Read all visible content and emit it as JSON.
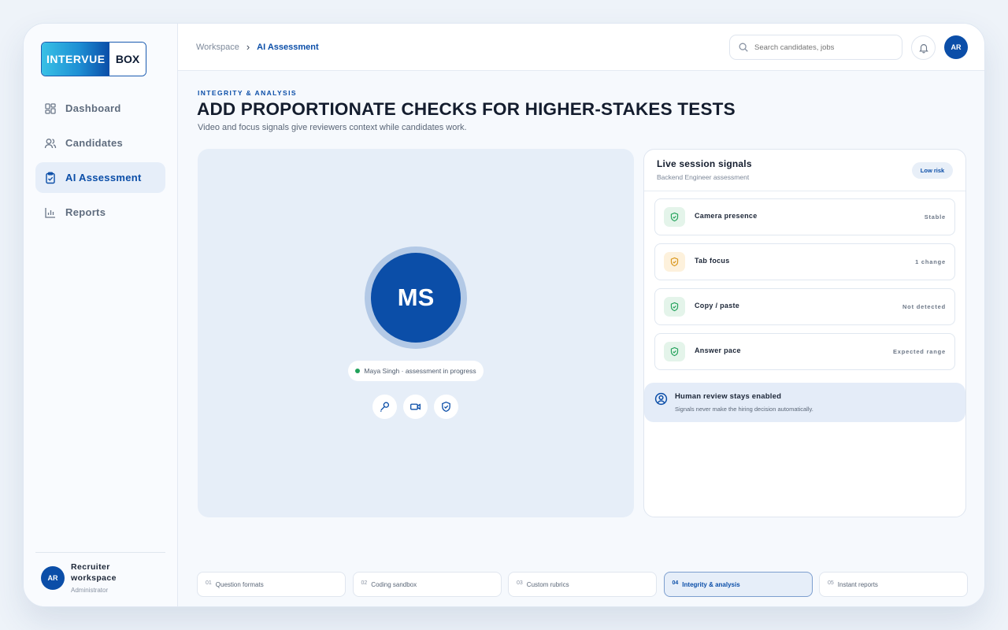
{
  "logo": {
    "left": "INTERVUE",
    "right": "BOX"
  },
  "sidebar": {
    "items": [
      {
        "label": "Dashboard",
        "icon": "dashboard-icon",
        "active": false
      },
      {
        "label": "Candidates",
        "icon": "users-icon",
        "active": false
      },
      {
        "label": "AI Assessment",
        "icon": "clipboard-check-icon",
        "active": true
      },
      {
        "label": "Reports",
        "icon": "bar-chart-icon",
        "active": false
      }
    ],
    "user": {
      "initials": "AR",
      "name": "Recruiter workspace",
      "role": "Administrator"
    }
  },
  "header": {
    "breadcrumb": {
      "root": "Workspace",
      "current": "AI Assessment"
    },
    "search_placeholder": "Search candidates, jobs",
    "avatar_initials": "AR"
  },
  "main": {
    "eyebrow": "INTEGRITY & ANALYSIS",
    "title": "ADD PROPORTIONATE CHECKS FOR HIGHER-STAKES TESTS",
    "subtitle": "Video and focus signals give reviewers context while candidates work."
  },
  "video": {
    "initials": "MS",
    "status": "Maya Singh · assessment in progress",
    "status_color": "#21a15a"
  },
  "panel": {
    "title": "Live session signals",
    "subtitle": "Backend Engineer assessment",
    "risk_badge": "Low risk",
    "signals": [
      {
        "label": "Camera presence",
        "value": "Stable",
        "tone": "green"
      },
      {
        "label": "Tab focus",
        "value": "1 change",
        "tone": "amber"
      },
      {
        "label": "Copy / paste",
        "value": "Not detected",
        "tone": "green"
      },
      {
        "label": "Answer pace",
        "value": "Expected range",
        "tone": "green"
      }
    ],
    "human": {
      "title": "Human review stays enabled",
      "subtitle": "Signals never make the hiring decision automatically."
    }
  },
  "steps": [
    {
      "num": "01",
      "label": "Question formats",
      "active": false
    },
    {
      "num": "02",
      "label": "Coding sandbox",
      "active": false
    },
    {
      "num": "03",
      "label": "Custom rubrics",
      "active": false
    },
    {
      "num": "04",
      "label": "Integrity & analysis",
      "active": true
    },
    {
      "num": "05",
      "label": "Instant reports",
      "active": false
    }
  ],
  "colors": {
    "accent": "#0b4ea8",
    "success": "#21a15a",
    "warning": "#d9961a"
  }
}
